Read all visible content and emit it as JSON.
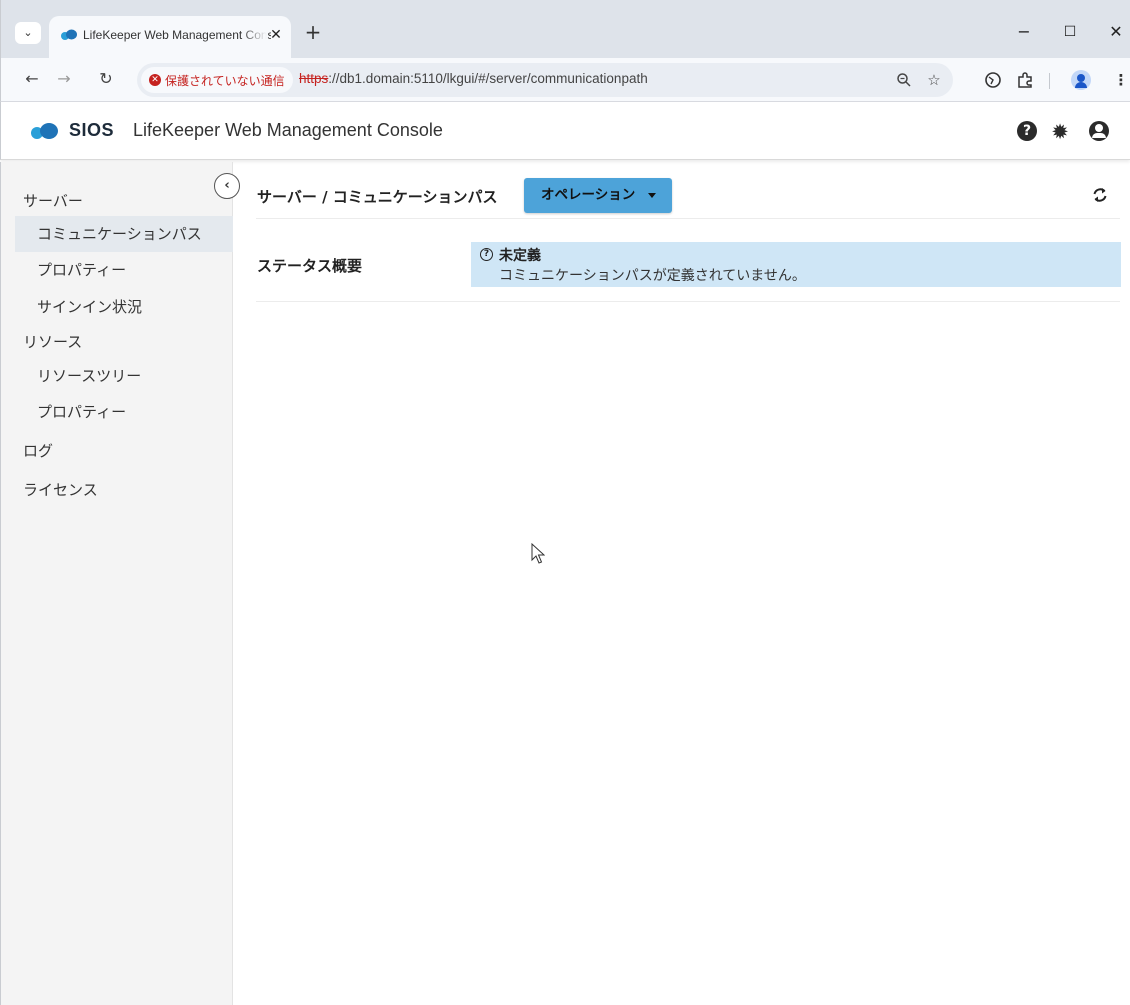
{
  "browser": {
    "tab_title": "LifeKeeper Web Management Console",
    "tab_close": "✕",
    "new_tab": "+",
    "security_label": "保護されていない通信",
    "url_scheme": "https",
    "url_rest": "://db1.domain:5110/lkgui/#/server/communicationpath",
    "window_controls": {
      "minimize": "−",
      "maximize": "☐",
      "close": "✕"
    }
  },
  "header": {
    "logo_text": "SIOS",
    "title": "LifeKeeper Web Management Console"
  },
  "sidebar": {
    "groups": [
      {
        "label": "サーバー",
        "items": [
          {
            "label": "コミュニケーションパス",
            "active": true
          },
          {
            "label": "プロパティー"
          },
          {
            "label": "サインイン状況"
          }
        ]
      },
      {
        "label": "リソース",
        "items": [
          {
            "label": "リソースツリー"
          },
          {
            "label": "プロパティー"
          }
        ]
      },
      {
        "label": "ログ",
        "items": []
      },
      {
        "label": "ライセンス",
        "items": []
      }
    ]
  },
  "main": {
    "breadcrumb": "サーバー / コミュニケーションパス",
    "operation_button": "オペレーション",
    "status_label": "ステータス概要",
    "status_title": "未定義",
    "status_message": "コミュニケーションパスが定義されていません。"
  },
  "icons": {
    "tab_list": "chevron-down-icon",
    "back": "arrow-left-icon",
    "forward": "arrow-right-icon",
    "reload": "reload-icon",
    "security": "warning-circle-icon",
    "zoom": "zoom-icon",
    "bookmark": "star-icon",
    "extension_a": "extension-icon",
    "extensions": "puzzle-icon",
    "profile": "profile-icon",
    "menu": "kebab-menu-icon",
    "help": "question-circle-icon",
    "settings": "gear-icon",
    "account": "user-circle-icon",
    "collapse": "chevron-left-icon",
    "refresh": "refresh-icon",
    "status": "question-icon"
  },
  "colors": {
    "accent": "#4da3d9",
    "status_bg": "#cfe6f6",
    "insecure": "#c5221f",
    "sidebar_bg": "#f4f4f4",
    "active_item_bg": "#e4e9ee"
  }
}
